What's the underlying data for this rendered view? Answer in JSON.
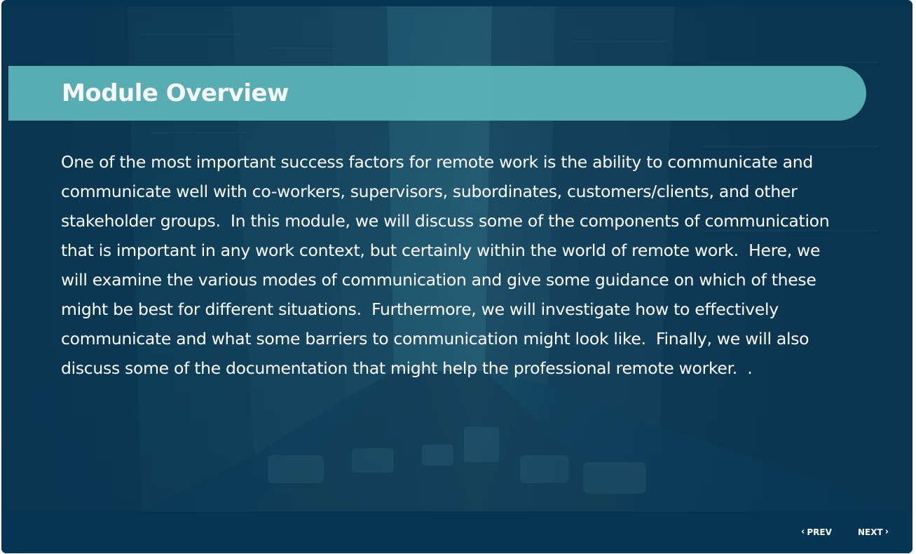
{
  "slide": {
    "title": "Module Overview",
    "body": "One of the most important success factors for remote work is the ability to communicate and communicate well with co-workers, supervisors, subordinates, customers/clients, and other stakeholder groups.  In this module, we will discuss some of the components of communication that is important in any work context, but certainly within the world of remote work.  Here, we will examine the various modes of communication and give some guidance on which of these might be best for different situations.  Furthermore, we will investigate how to effectively communicate and what some barriers to communication might look like.  Finally, we will also discuss some of the documentation that might help the professional remote worker.  ."
  },
  "footer": {
    "prev_label": "PREV",
    "next_label": "NEXT",
    "prev_icon": "chevron-left-icon",
    "next_icon": "chevron-right-icon"
  },
  "colors": {
    "background": "#053552",
    "title_bar": "#5ab1b5",
    "text": "#ffffff"
  }
}
